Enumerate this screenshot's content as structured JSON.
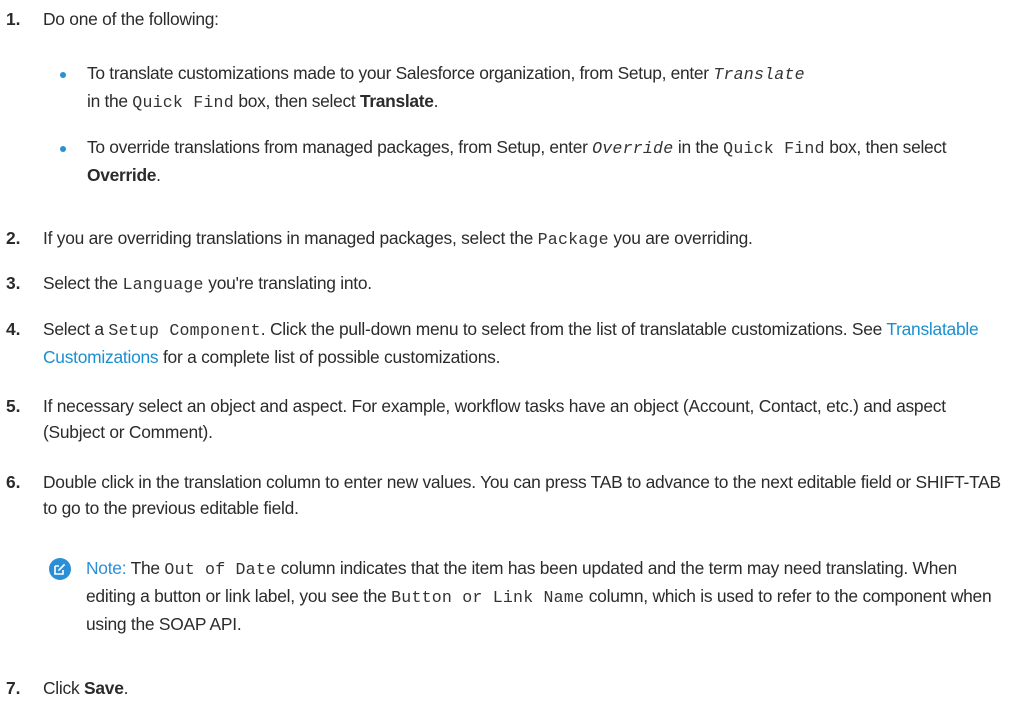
{
  "steps": [
    {
      "num": "1.",
      "text": "Do one of the following:"
    },
    {
      "num": "2.",
      "a": "If you are overriding translations in managed packages, select the ",
      "code": "Package",
      "b": " you are overriding."
    },
    {
      "num": "3.",
      "a": "Select the ",
      "code": "Language",
      "b": " you're translating into."
    },
    {
      "num": "4.",
      "a": "Select a ",
      "code": "Setup Component",
      "b": ". Click the pull-down menu to select from the list of translatable customizations. See ",
      "link": "Translatable Customizations",
      "c": " for a complete list of possible customizations."
    },
    {
      "num": "5.",
      "text": "If necessary select an object and aspect. For example, workflow tasks have an object (Account, Contact, etc.) and aspect (Subject or Comment)."
    },
    {
      "num": "6.",
      "text": "Double click in the translation column to enter new values. You can press TAB to advance to the next editable field or SHIFT-TAB to go to the previous editable field."
    },
    {
      "num": "7.",
      "a": "Click ",
      "bold": "Save",
      "b": "."
    }
  ],
  "bullets": [
    {
      "a": "To translate customizations made to your Salesforce organization, from Setup, enter ",
      "code": "Translate",
      "b": " in the ",
      "code2": "Quick Find",
      "c": " box, then select ",
      "bold": "Translate",
      "d": "."
    },
    {
      "a": "To override translations from managed packages, from Setup, enter ",
      "code": "Override",
      "b": " in the ",
      "code2": "Quick Find",
      "c": " box, then select ",
      "bold": "Override",
      "d": "."
    }
  ],
  "note": {
    "label": "Note:",
    "a": " The ",
    "code": "Out of Date",
    "b": " column indicates that the item has been updated and the term may need translating. When editing a button or link label, you see the ",
    "code2": "Button or Link Name",
    "c": " column, which is used to refer to the component when using the SOAP API."
  },
  "colors": {
    "accent": "#2b8fd8",
    "link": "#1a8fd0",
    "text": "#2b2b2b"
  },
  "icons": {
    "note": "edit-note-icon",
    "bullet": "bullet-dot"
  }
}
